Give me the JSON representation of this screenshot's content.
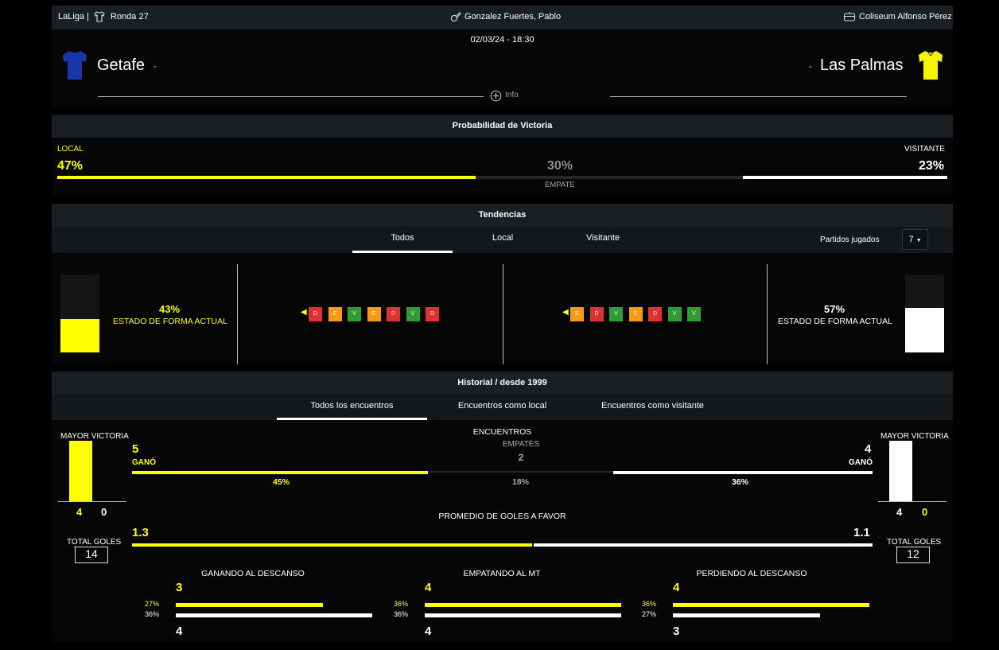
{
  "header": {
    "competition": "LaLiga |",
    "round": "Ronda 27",
    "referee": "Gonzalez Fuertes, Pablo",
    "stadium": "Coliseum Alfonso Pérez",
    "datetime": "02/03/24 - 18:30",
    "home_team": "Getafe",
    "away_team": "Las Palmas",
    "info_label": "Info",
    "home_shirt_color": "#1537a8",
    "away_shirt_color": "#f5f500"
  },
  "probability": {
    "title": "Probabilidad de Victoria",
    "local_label": "LOCAL",
    "local_value": "47%",
    "draw_value": "30%",
    "draw_label": "EMPATE",
    "away_label": "VISITANTE",
    "away_value": "23%",
    "local_fraction": 0.47,
    "draw_fraction": 0.3,
    "away_fraction": 0.23
  },
  "trends": {
    "title": "Tendencias",
    "tabs": [
      "Todos",
      "Local",
      "Visitante"
    ],
    "active_tab": "Todos",
    "played_label": "Partidos jugados",
    "played_value": "7",
    "home_form_pct": "43%",
    "home_form_label": "ESTADO DE FORMA ACTUAL",
    "home_form_fraction": 0.43,
    "away_form_pct": "57%",
    "away_form_label": "ESTADO DE FORMA ACTUAL",
    "away_form_fraction": 0.57,
    "home_results": [
      "D",
      "E",
      "V",
      "E",
      "D",
      "V",
      "D"
    ],
    "away_results": [
      "E",
      "D",
      "V",
      "E",
      "D",
      "V",
      "V"
    ]
  },
  "history": {
    "title": "Historial / desde 1999",
    "tabs": [
      "Todos los encuentros",
      "Encuentros como local",
      "Encuentros como visitante"
    ],
    "active_tab": "Todos los encuentros",
    "biggest_win_label": "MAYOR VICTORIA",
    "home_big_win": [
      "4",
      "0"
    ],
    "away_big_win": [
      "4",
      "0"
    ],
    "encounters_label": "ENCUENTROS",
    "draws_label": "EMPATES",
    "draws_value": "2",
    "home_wins": "5",
    "away_wins": "4",
    "won_label": "GANÓ",
    "home_win_pct": "45%",
    "draw_pct": "18%",
    "away_win_pct": "36%",
    "home_win_fraction": 0.45,
    "draw_fraction": 0.18,
    "away_win_fraction": 0.36,
    "avg_goals_label": "PROMEDIO DE GOLES A FAVOR",
    "home_avg_goals": "1.3",
    "away_avg_goals": "1.1",
    "total_goals_label": "TOTAL GOLES",
    "home_total_goals": "14",
    "away_total_goals": "12",
    "halftime": [
      {
        "label": "GANANDO AL DESCANSO",
        "home_value": "3",
        "home_pct": "27%",
        "away_pct": "36%",
        "away_value": "4",
        "home_fraction": 0.27,
        "away_fraction": 0.36
      },
      {
        "label": "EMPATANDO AL MT",
        "home_value": "4",
        "home_pct": "36%",
        "away_pct": "36%",
        "away_value": "4",
        "home_fraction": 0.36,
        "away_fraction": 0.36
      },
      {
        "label": "PERDIENDO AL DESCANSO",
        "home_value": "4",
        "home_pct": "36%",
        "away_pct": "27%",
        "away_value": "3",
        "home_fraction": 0.36,
        "away_fraction": 0.27
      }
    ]
  }
}
